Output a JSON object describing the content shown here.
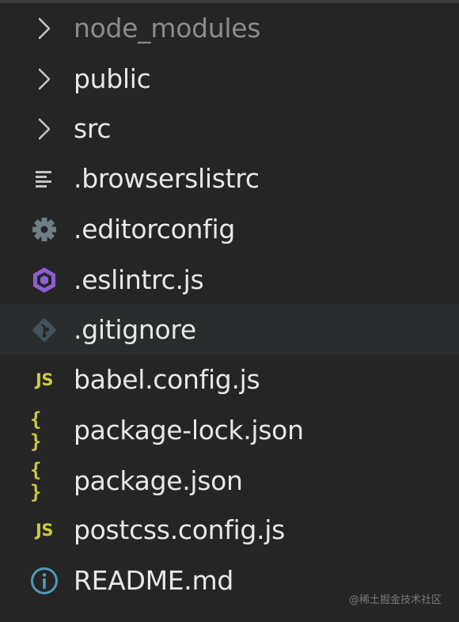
{
  "explorer": {
    "items": [
      {
        "label": "node_modules",
        "icon": "chevron-right-icon",
        "type": "folder"
      },
      {
        "label": "public",
        "icon": "chevron-right-icon",
        "type": "folder"
      },
      {
        "label": "src",
        "icon": "chevron-right-icon",
        "type": "folder"
      },
      {
        "label": ".browserslistrc",
        "icon": "lines-file-icon",
        "type": "file"
      },
      {
        "label": ".editorconfig",
        "icon": "gear-icon",
        "type": "file"
      },
      {
        "label": ".eslintrc.js",
        "icon": "eslint-icon",
        "type": "file"
      },
      {
        "label": ".gitignore",
        "icon": "git-icon",
        "type": "file"
      },
      {
        "label": "babel.config.js",
        "icon": "js-file-icon",
        "icon_text": "JS",
        "type": "file"
      },
      {
        "label": "package-lock.json",
        "icon": "json-file-icon",
        "icon_text": "{ }",
        "type": "file"
      },
      {
        "label": "package.json",
        "icon": "json-file-icon",
        "icon_text": "{ }",
        "type": "file"
      },
      {
        "label": "postcss.config.js",
        "icon": "js-file-icon",
        "icon_text": "JS",
        "type": "file"
      },
      {
        "label": "README.md",
        "icon": "info-icon",
        "type": "file"
      }
    ]
  },
  "colors": {
    "background": "#252526",
    "hover_row": "#2a2d2e",
    "text": "#e8e8e8",
    "dim_text": "#8c8c8c",
    "js_yellow": "#cbcb41",
    "eslint_purple": "#8f5fd1",
    "info_blue": "#519aba",
    "git_slate": "#41535b"
  },
  "watermark": "@稀土掘金技术社区"
}
